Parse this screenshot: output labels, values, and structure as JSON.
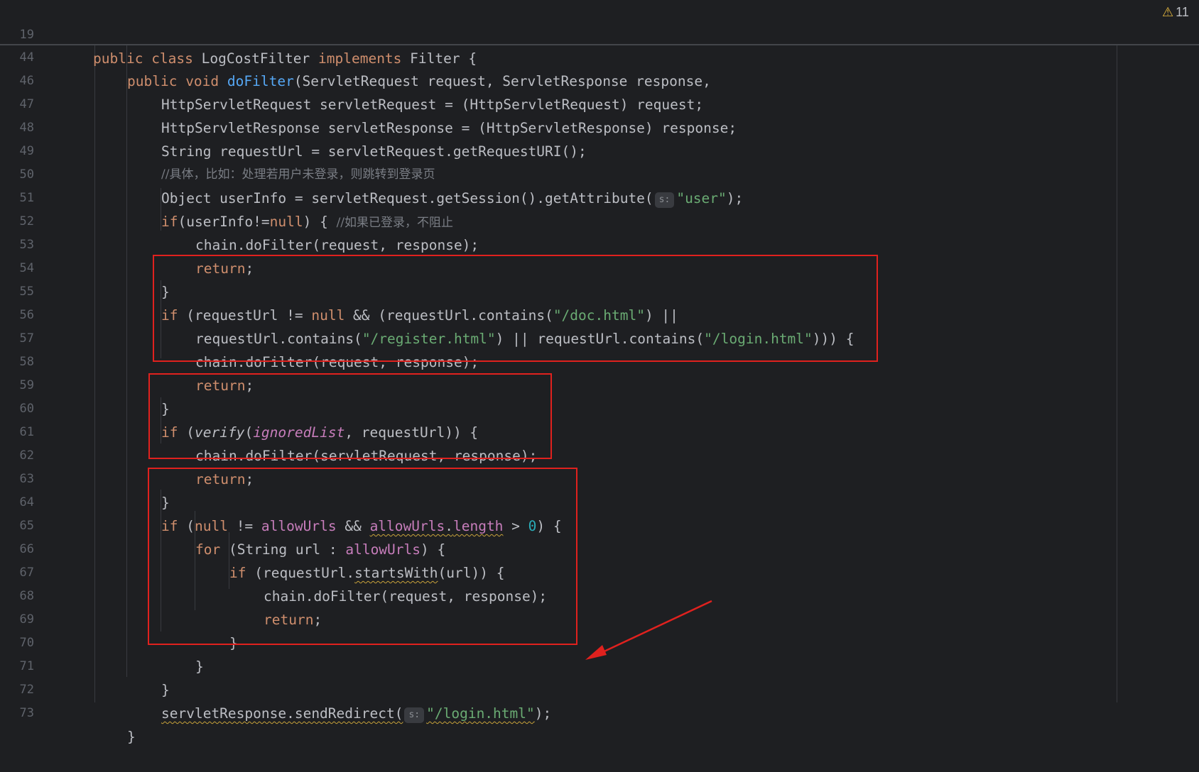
{
  "editor": {
    "warning_icon": "warning-triangle-icon",
    "warning_count": "11",
    "colors": {
      "background": "#1e1f22",
      "keyword": "#cf8e6d",
      "function": "#56a8f5",
      "string": "#6aab73",
      "comment": "#7a7e85",
      "field": "#c77dbb",
      "number": "#2aacb8",
      "highlight_box": "#e0211e"
    },
    "hint_label": "s:",
    "line_numbers": [
      "19",
      "44",
      "46",
      "47",
      "48",
      "49",
      "50",
      "51",
      "52",
      "53",
      "54",
      "55",
      "56",
      "57",
      "58",
      "59",
      "60",
      "61",
      "62",
      "63",
      "64",
      "65",
      "66",
      "67",
      "68",
      "69",
      "70",
      "71",
      "72",
      "73"
    ],
    "sticky": {
      "l19": [
        "public ",
        "class ",
        "LogCostFilter ",
        "implements ",
        "Filter {"
      ],
      "l44": [
        "public ",
        "void ",
        "doFilter",
        "(ServletRequest request, ServletResponse response,"
      ]
    },
    "code": {
      "l46": "HttpServletRequest servletRequest = (HttpServletRequest) request;",
      "l47": "HttpServletResponse servletResponse = (HttpServletResponse) response;",
      "l48": "String requestUrl = servletRequest.getRequestURI();",
      "l49": "//具体，比如：处理若用户未登录，则跳转到登录页",
      "l50": [
        "Object userInfo = servletRequest.getSession().getAttribute(",
        "\"user\"",
        ");"
      ],
      "l51": [
        "if",
        "(userInfo!=",
        "null",
        ") { ",
        "//如果已登录，不阻止"
      ],
      "l52": "chain.doFilter(request, response);",
      "l53": [
        "return",
        ";"
      ],
      "l54": "}",
      "l55": [
        "if ",
        "(requestUrl != ",
        "null ",
        "&& (requestUrl.contains(",
        "\"/doc.html\"",
        ") ||"
      ],
      "l56": [
        "requestUrl.contains(",
        "\"/register.html\"",
        ") || requestUrl.contains(",
        "\"/login.html\"",
        "))) {"
      ],
      "l57": "chain.doFilter(request, response);",
      "l58": [
        "return",
        ";"
      ],
      "l59": "}",
      "l60": [
        "if ",
        "(",
        "verify",
        "(",
        "ignoredList",
        ", requestUrl)) {"
      ],
      "l61": "chain.doFilter(servletRequest, response);",
      "l62": [
        "return",
        ";"
      ],
      "l63": "}",
      "l64": [
        "if ",
        "(",
        "null ",
        "!= ",
        "allowUrls",
        " && ",
        "allowUrls",
        ".",
        "length",
        " > ",
        "0",
        ") {"
      ],
      "l65": [
        "for ",
        "(String url : ",
        "allowUrls",
        ") {"
      ],
      "l66": [
        "if ",
        "(requestUrl.",
        "startsWith",
        "(url)) {"
      ],
      "l67": "chain.doFilter(request, response);",
      "l68": [
        "return",
        ";"
      ],
      "l69": "}",
      "l70": "}",
      "l71": "}",
      "l72": [
        "servletResponse.sendRedirect(",
        "\"/login.html\"",
        ");"
      ],
      "l73": "}"
    }
  }
}
